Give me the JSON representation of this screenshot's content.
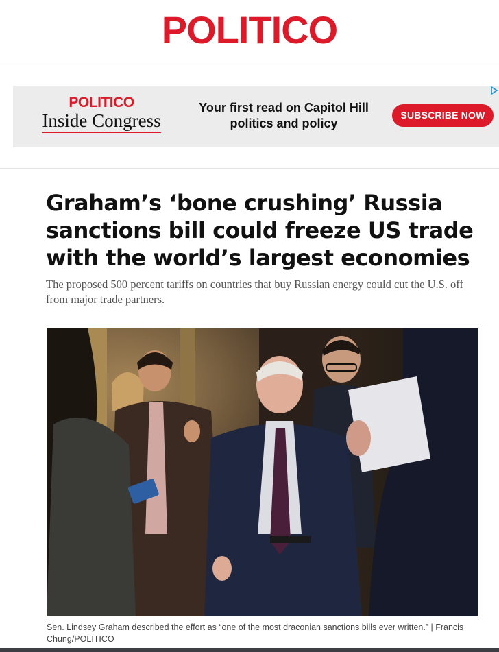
{
  "masthead": {
    "logo_text": "POLITICO"
  },
  "ad": {
    "brand_top": "POLITICO",
    "brand_bottom": "Inside Congress",
    "copy_line1": "Your first read on Capitol Hill",
    "copy_line2": "politics and policy",
    "cta": "SUBSCRIBE NOW",
    "choice_icon": "ad-choices-icon"
  },
  "article": {
    "headline": "Graham’s ‘bone crushing’ Russia sanctions bill could freeze US trade with the world’s largest economies",
    "dek": "The proposed 500 percent tariffs on countries that buy Russian energy could cut the U.S. off from major trade partners.",
    "caption": "Sen. Lindsey Graham described the effort as “one of the most draconian sanctions bills ever written.” | Francis Chung/POLITICO"
  },
  "colors": {
    "brand_red": "#dc1a2a",
    "ad_bg": "#ececec",
    "dek_gray": "#555555"
  }
}
